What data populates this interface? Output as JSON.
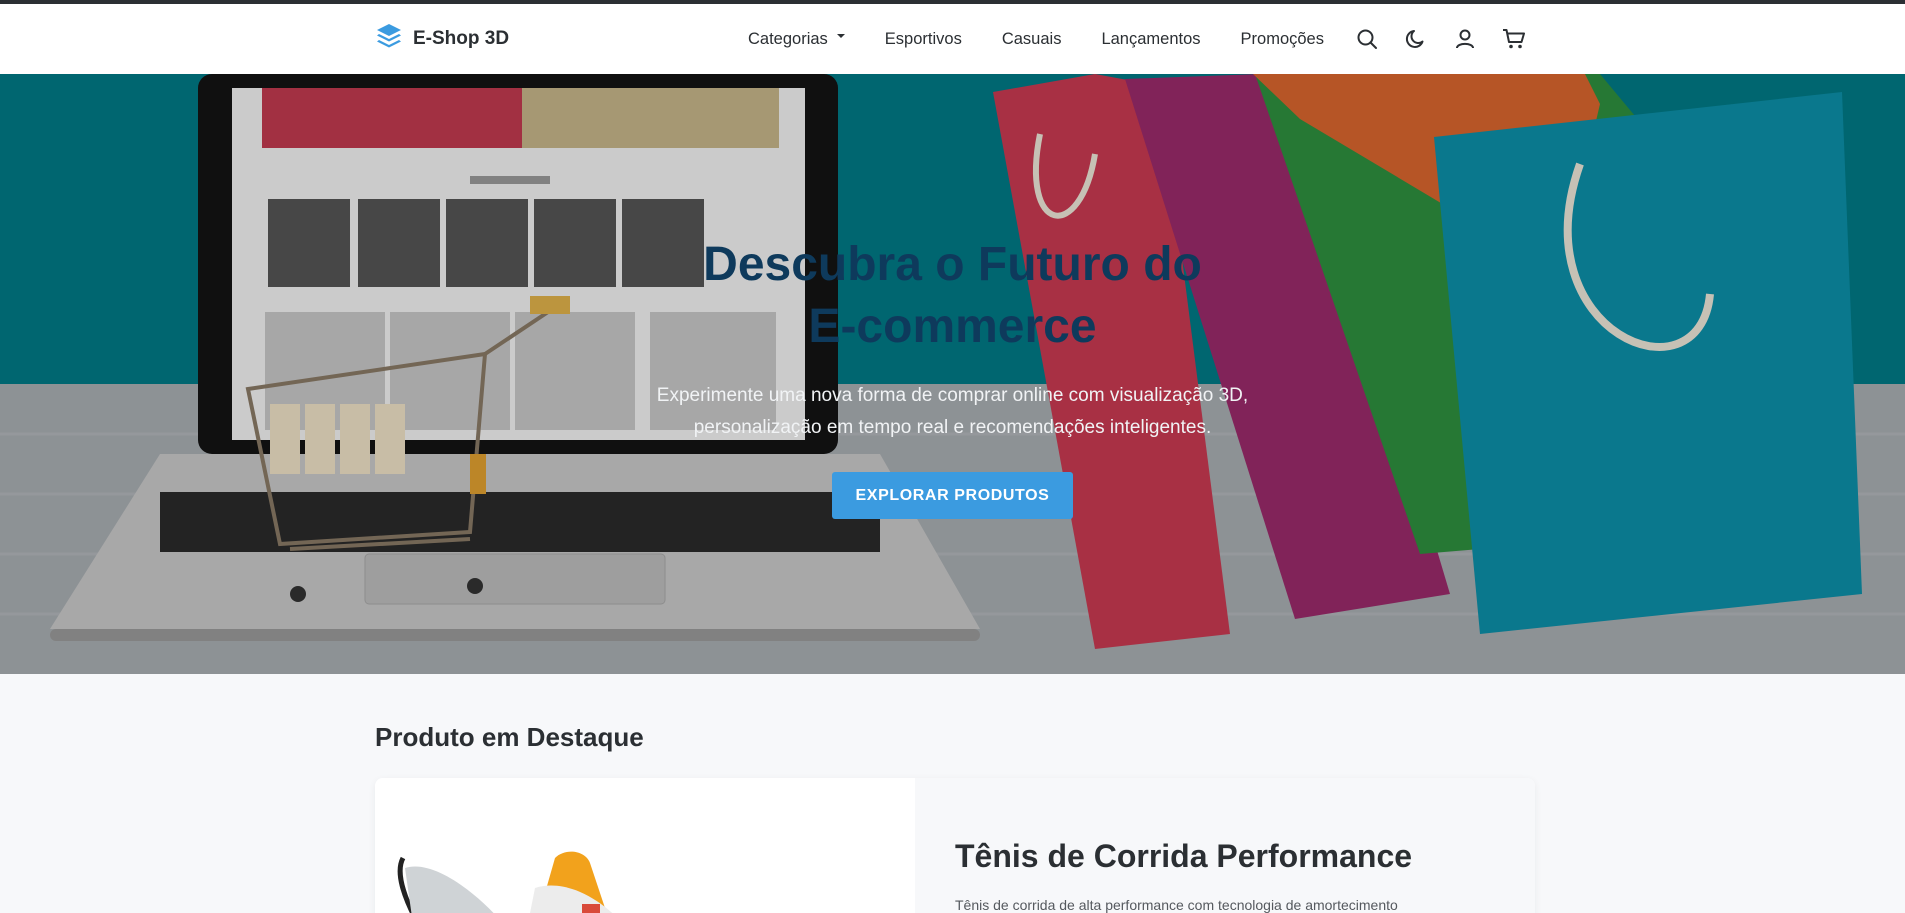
{
  "brand": {
    "name": "E-Shop 3D",
    "icon": "layers-icon",
    "accent": "#3b9be0"
  },
  "nav": {
    "items": [
      {
        "label": "Categorias",
        "dropdown": true
      },
      {
        "label": "Esportivos"
      },
      {
        "label": "Casuais"
      },
      {
        "label": "Lançamentos"
      },
      {
        "label": "Promoções"
      }
    ],
    "icons": [
      "search-icon",
      "moon-icon",
      "user-icon",
      "cart-icon"
    ]
  },
  "hero": {
    "title": "Descubra o Futuro do E-commerce",
    "subtitle": "Experimente uma nova forma de comprar online com visualização 3D, personalização em tempo real e recomendações inteligentes.",
    "cta": "EXPLORAR PRODUTOS"
  },
  "featured": {
    "section_title": "Produto em Destaque",
    "product_name": "Tênis de Corrida Performance",
    "product_desc": "Tênis de corrida de alta performance com tecnologia de amortecimento"
  }
}
